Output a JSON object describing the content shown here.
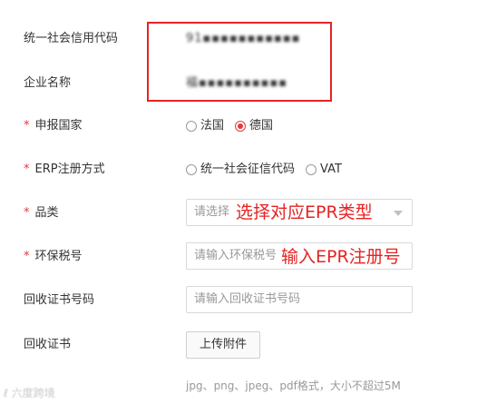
{
  "form": {
    "credit_code": {
      "label": "统一社会信用代码",
      "value": "91▪▪▪▪▪▪▪▪▪▪▪"
    },
    "company_name": {
      "label": "企业名称",
      "value": "福▪▪▪▪▪▪▪▪▪▪"
    },
    "country": {
      "required_mark": "*",
      "label": "申报国家",
      "options": [
        {
          "label": "法国",
          "checked": false
        },
        {
          "label": "德国",
          "checked": true
        }
      ]
    },
    "erp_method": {
      "required_mark": "*",
      "label": "ERP注册方式",
      "options": [
        {
          "label": "统一社会征信代码",
          "checked": false
        },
        {
          "label": "VAT",
          "checked": false
        }
      ]
    },
    "category": {
      "required_mark": "*",
      "label": "品类",
      "placeholder": "请选择",
      "annotation": "选择对应EPR类型"
    },
    "env_tax": {
      "required_mark": "*",
      "label": "环保税号",
      "placeholder": "请输入环保税号",
      "annotation": "输入EPR注册号"
    },
    "recycle_no": {
      "label": "回收证书号码",
      "placeholder": "请输入回收证书号码"
    },
    "recycle_cert": {
      "label": "回收证书",
      "upload_label": "上传附件",
      "hint": "jpg、png、jpeg、pdf格式，大小不超过5M"
    }
  },
  "watermark": "ℓ 六度跨境",
  "colors": {
    "accent": "#e4393c",
    "annotation": "#e62323"
  }
}
